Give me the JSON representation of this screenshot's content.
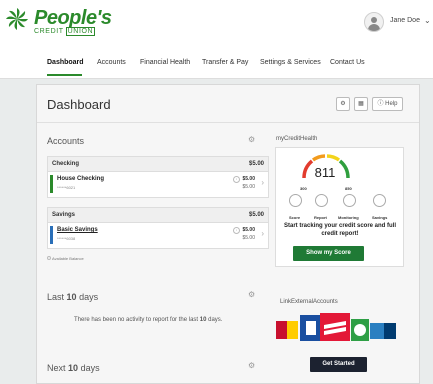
{
  "brand": {
    "name": "People's",
    "sub_left": "CREDIT",
    "sub_box": "UNION",
    "color": "#2b8a2b"
  },
  "user": {
    "name": "Jane Doe"
  },
  "nav": {
    "items": [
      "Dashboard",
      "Accounts",
      "Financial Health",
      "Transfer & Pay",
      "Settings & Services",
      "Contact Us"
    ],
    "active": "Dashboard"
  },
  "dashboard": {
    "title": "Dashboard",
    "help_label": "Help"
  },
  "accounts": {
    "title": "Accounts",
    "groups": [
      {
        "label": "Checking",
        "total": "$5.00",
        "account": {
          "name": "House Checking",
          "number": "******6021",
          "balance": "$5.00",
          "available": "$5.00",
          "color": "#2b8a2b"
        }
      },
      {
        "label": "Savings",
        "total": "$5.00",
        "account": {
          "name": "Basic Savings",
          "number": "******6038",
          "balance": "$5.00",
          "available": "$5.00",
          "color": "#2a6fb8"
        }
      }
    ],
    "available_note": "Available Balance"
  },
  "last_days": {
    "prefix": "Last",
    "count": "10",
    "suffix": "days",
    "message_prefix": "There has been no activity to report for the last",
    "message_count": "10",
    "message_suffix": "days."
  },
  "next_days": {
    "prefix": "Next",
    "count": "10",
    "suffix": "days"
  },
  "my_credit_health": {
    "title": "myCreditHealth",
    "score": "811",
    "range_min": "300",
    "range_max": "850",
    "features": [
      "Score",
      "Report",
      "Monitoring",
      "Savings"
    ],
    "message": "Start tracking your credit score and full credit report!",
    "button": "Show my Score"
  },
  "link_external": {
    "title": "LinkExternalAccounts",
    "button": "Get Started"
  },
  "icons": {
    "settings": "gear-icon",
    "user": "user-icon",
    "chevron": "chevron-down-icon"
  }
}
